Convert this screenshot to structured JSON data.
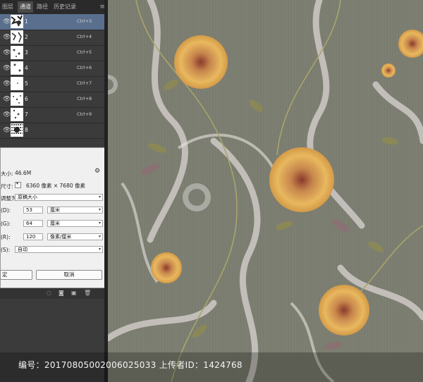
{
  "panel": {
    "tabs": [
      {
        "label": "图层"
      },
      {
        "label": "通道"
      },
      {
        "label": "路径"
      },
      {
        "label": "历史记录"
      }
    ],
    "active_tab": "通道",
    "channels": [
      {
        "name": "1",
        "shortcut": "Ctrl+3",
        "selected": true
      },
      {
        "name": "2",
        "shortcut": "Ctrl+4"
      },
      {
        "name": "3",
        "shortcut": "Ctrl+5"
      },
      {
        "name": "4",
        "shortcut": "Ctrl+6"
      },
      {
        "name": "5",
        "shortcut": "Ctrl+7"
      },
      {
        "name": "6",
        "shortcut": "Ctrl+8"
      },
      {
        "name": "7",
        "shortcut": "Ctrl+9"
      },
      {
        "name": "8",
        "shortcut": ""
      }
    ]
  },
  "dialog": {
    "size_label": "大小:",
    "size_value": "46.6M",
    "dim_label": "尺寸:",
    "dim_value": "6360 像素 × 7680 像素",
    "adjust_label": "调整为:",
    "adjust_value": "原稿大小",
    "width_label": "(D):",
    "width_value": "53",
    "width_unit": "厘米",
    "height_label": "(G):",
    "height_value": "64",
    "height_unit": "厘米",
    "res_label": "(R):",
    "res_value": "120",
    "res_unit": "像素/厘米",
    "resample_label": "(S):",
    "resample_value": "自动",
    "ok_label": "定",
    "cancel_label": "取消"
  },
  "watermark": {
    "text": "编号：20170805002006025033 上传者ID：1424768"
  },
  "colors": {
    "canvas_bg": "#7d7f72",
    "selected_row": "#5a6f8e",
    "panel_bg": "#3b3b3b"
  }
}
